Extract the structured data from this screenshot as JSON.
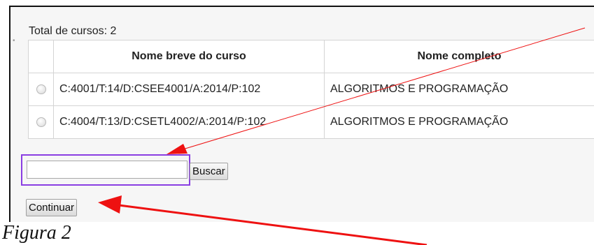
{
  "total_label": "Total de cursos: 2",
  "table": {
    "headers": [
      "",
      "Nome breve do curso",
      "Nome completo"
    ],
    "rows": [
      {
        "short_name": "C:4001/T:14/D:CSEE4001/A:2014/P:102",
        "full_name": "ALGORITMOS E PROGRAMAÇÃO"
      },
      {
        "short_name": "C:4004/T:13/D:CSETL4002/A:2014/P:102",
        "full_name": "ALGORITMOS E PROGRAMAÇÃO"
      }
    ]
  },
  "search": {
    "value": "",
    "button_label": "Buscar"
  },
  "continue_label": "Continuar",
  "caption": "Figura 2",
  "annotation_colors": {
    "arrow": "#ee1111",
    "highlight": "#8a3ee2"
  }
}
